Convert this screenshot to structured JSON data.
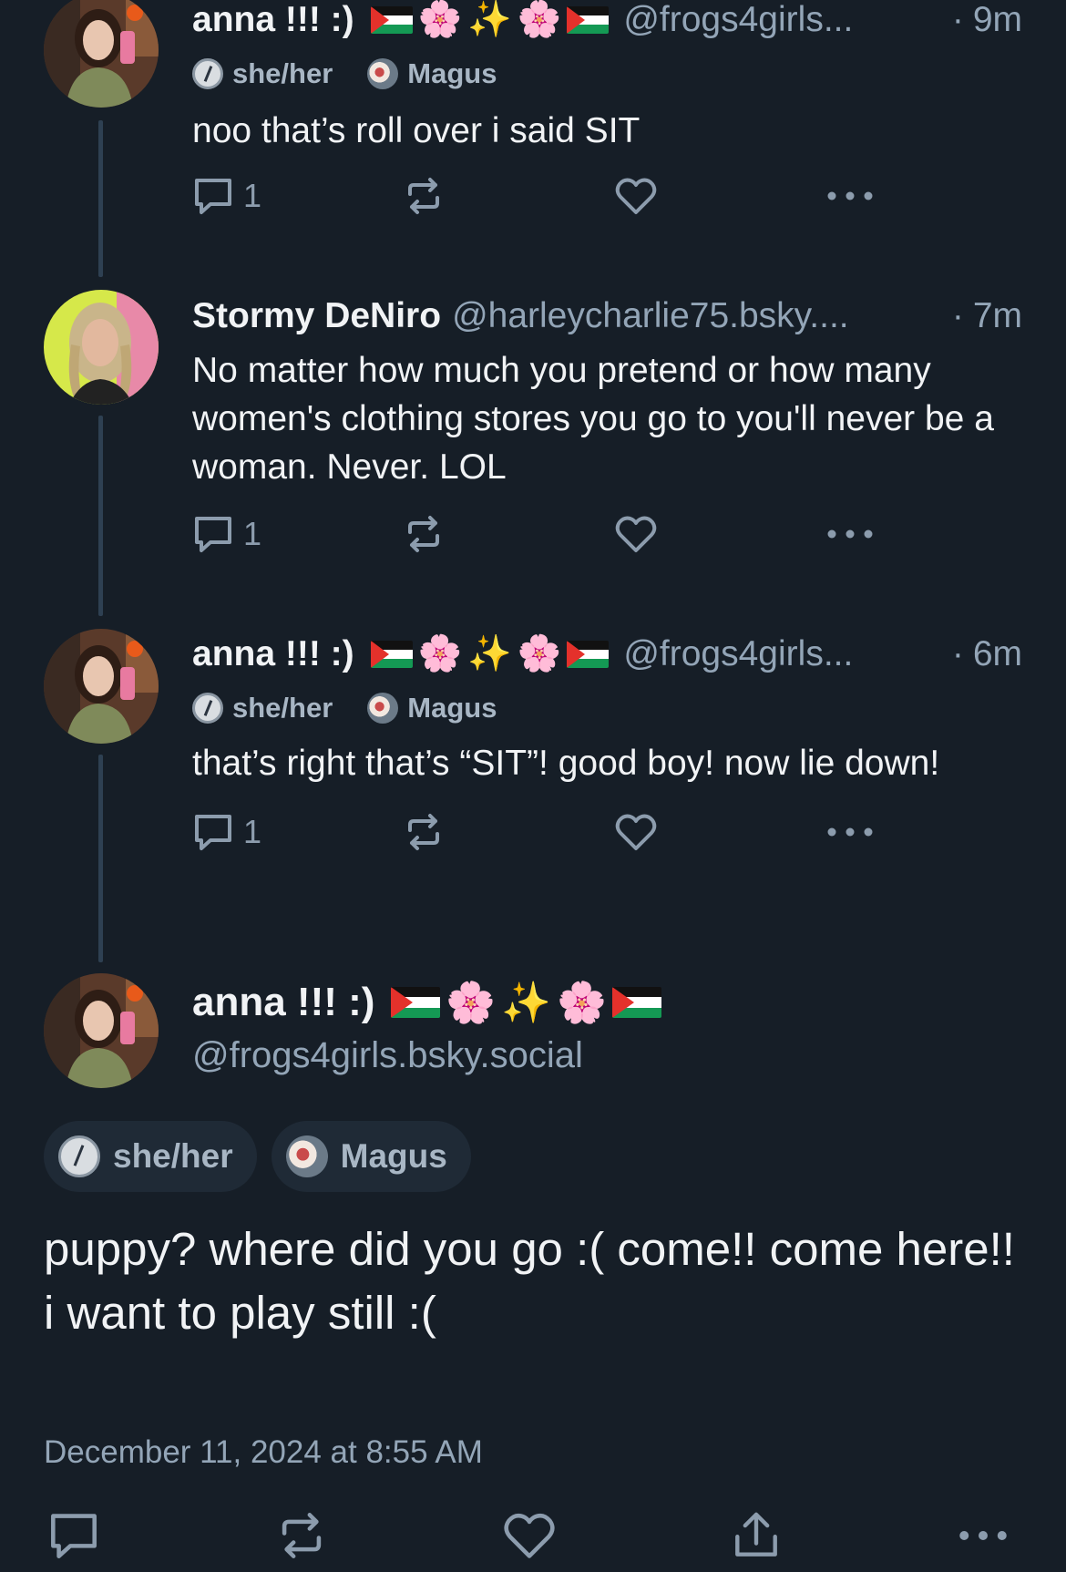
{
  "thread": [
    {
      "name": "anna !!! :)",
      "handle": "@frogs4girls...",
      "time": "9m",
      "labels": {
        "pronouns": "she/her",
        "badge": "Magus"
      },
      "text": "noo that’s roll over i said SIT",
      "reply_count": "1"
    },
    {
      "name": "Stormy DeNiro",
      "handle": "@harleycharlie75.bsky....",
      "time": "7m",
      "text": "No matter how much you pretend or how many women's clothing stores you go to you'll never be a woman. Never. LOL",
      "reply_count": "1"
    },
    {
      "name": "anna !!! :)",
      "handle": "@frogs4girls...",
      "time": "6m",
      "labels": {
        "pronouns": "she/her",
        "badge": "Magus"
      },
      "text": "that’s right that’s “SIT”! good boy! now lie down!",
      "reply_count": "1"
    }
  ],
  "main_post": {
    "name": "anna !!! :)",
    "handle": "@frogs4girls.bsky.social",
    "labels": {
      "pronouns": "she/her",
      "badge": "Magus"
    },
    "text": "puppy? where did you go :( come!! come here!! i want to play still :(",
    "date": "December 11, 2024 at 8:55 AM"
  },
  "name_emojis": [
    "palestine-flag",
    "🌸",
    "✨",
    "🌸",
    "palestine-flag"
  ],
  "icons": {
    "reply": "speech-bubble-icon",
    "repost": "repost-arrows-icon",
    "like": "heart-icon",
    "share": "share-upload-icon",
    "more": "ellipsis-icon"
  },
  "colors": {
    "background": "#161e27",
    "text": "#f1f3f5",
    "muted": "#93a5b7",
    "icon": "#8c9cad",
    "thread_line": "#2e4052",
    "pill": "#1f2a36"
  }
}
